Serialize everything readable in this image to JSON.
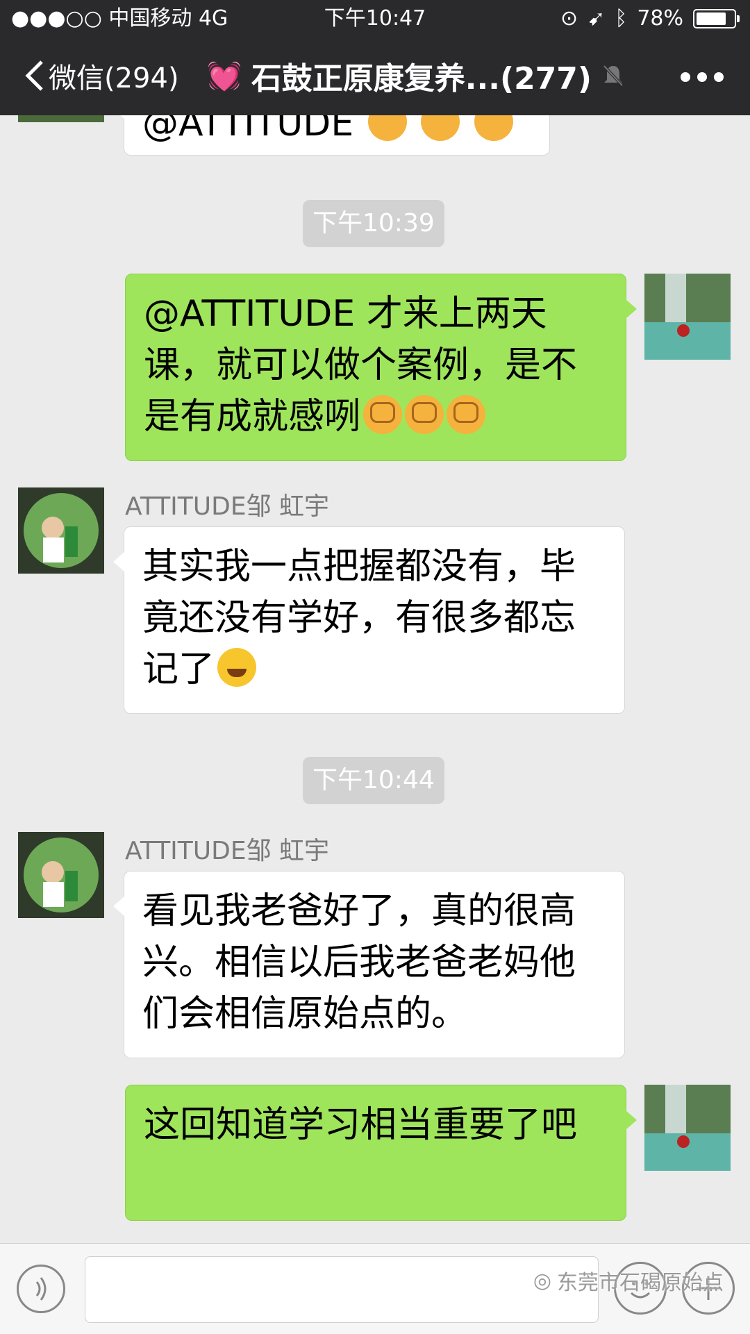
{
  "status_bar": {
    "carrier": "●●●○○ 中国移动   4G",
    "time": "下午10:47",
    "battery": "78%",
    "battery_level": 0.78
  },
  "nav": {
    "back_label": "微信(294)",
    "title": "石鼓正原康复养...(277)"
  },
  "chat": {
    "partial_top_message": "@ATTITUDE",
    "messages": [
      {
        "type": "time",
        "text": "下午10:39"
      },
      {
        "type": "sent",
        "text": "@ATTITUDE 才来上两天课，就可以做个案例，是不是有成就感咧",
        "emojis": [
          "fist",
          "fist",
          "fist"
        ]
      },
      {
        "type": "received",
        "sender": "ATTITUDE邹 虹宇",
        "text": "其实我一点把握都没有，毕竟还没有学好，有很多都忘记了",
        "emojis": [
          "laugh"
        ]
      },
      {
        "type": "time",
        "text": "下午10:44"
      },
      {
        "type": "received",
        "sender": "ATTITUDE邹 虹宇",
        "text": "看见我老爸好了，真的很高兴。相信以后我老爸老妈他们会相信原始点的。"
      },
      {
        "type": "sent",
        "text": "这回知道学习相当重要了吧"
      }
    ]
  },
  "input_bar": {
    "icons": [
      "voice-icon",
      "emoji-icon",
      "plus-icon"
    ]
  },
  "watermark": "东莞市石碣原始点",
  "colors": {
    "nav_bg": "#2a2a2c",
    "chat_bg": "#ebebeb",
    "sent_bubble": "#9fe55b",
    "received_bubble": "#ffffff"
  }
}
